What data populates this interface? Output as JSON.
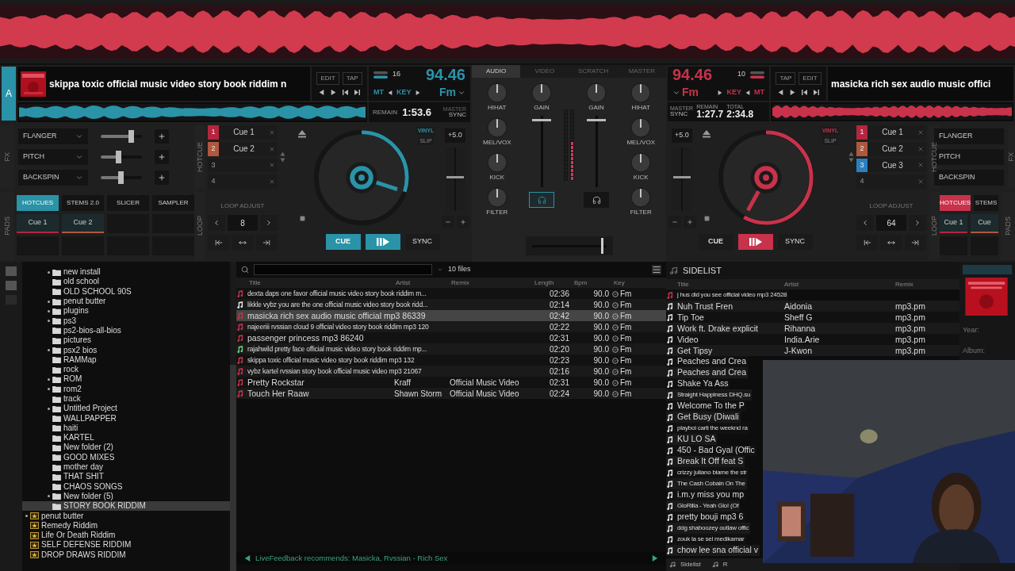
{
  "decks": [
    {
      "letter": "A",
      "art": {
        "kind": "picture"
      },
      "title": "skippa toxic official music video story book riddim n",
      "edit": "EDIT",
      "tap": "TAP",
      "pitch_range": "16",
      "bpm": "94.46",
      "mt": "MT",
      "key_label": "KEY",
      "key": "Fm",
      "remain_label": "REMAIN",
      "remain": "1:53.6",
      "master": "MASTER",
      "sync_label": "SYNC",
      "color": "#2a93a8",
      "position": {
        "level": 0.3
      },
      "fx_label": "FX",
      "fx": [
        {
          "name": "FLANGER",
          "level": 0.75
        },
        {
          "name": "PITCH",
          "level": 0.45
        },
        {
          "name": "BACKSPIN",
          "level": 0.5
        }
      ],
      "hotcue_label": "HOTCUE",
      "hotcues": [
        {
          "number": "1",
          "label": "Cue 1",
          "color": "#b3263e"
        },
        {
          "number": "2",
          "label": "Cue 2",
          "color": "#b0583c"
        },
        {
          "number": "3"
        },
        {
          "number": "4"
        }
      ],
      "pads_label": "PADS",
      "pad_tabs": [
        {
          "label": "HOTCUES",
          "selected": true
        },
        {
          "label": "STEMS 2.0",
          "selected": false
        },
        {
          "label": "SLICER",
          "selected": false
        },
        {
          "label": "SAMPLER",
          "selected": false
        }
      ],
      "pads": [
        {
          "label": "Cue 1",
          "color": "#b3263e"
        },
        {
          "label": "Cue 2",
          "color": "#b0583c"
        }
      ],
      "loop_label": "LOOP",
      "loop_title": "LOOP ADJUST",
      "loop_value": "8",
      "pitch": "+5.0",
      "vinyl": "VINYL",
      "slip": "SLIP",
      "cue": "CUE",
      "cue_active": true,
      "sync": "SYNC"
    },
    {
      "title": "masicka rich sex audio music offici",
      "edit": "EDIT",
      "tap": "TAP",
      "pitch_range": "10",
      "bpm": "94.46",
      "mt": "MT",
      "key_label": "KEY",
      "key": "Fm",
      "remain_label": "REMAIN",
      "remain": "1:27.7",
      "total_label": "TOTAL",
      "total": "2:34.8",
      "master": "MASTER",
      "sync_label": "SYNC",
      "color": "#c8324b",
      "position": {
        "level": 0.58
      },
      "fx_label": "FX",
      "fx": [
        {
          "name": "FLANGER"
        },
        {
          "name": "PITCH"
        },
        {
          "name": "BACKSPIN"
        }
      ],
      "hotcue_label": "HOTCUE",
      "hotcues": [
        {
          "number": "1",
          "label": "Cue 1",
          "color": "#b3263e"
        },
        {
          "number": "2",
          "label": "Cue 2",
          "color": "#b0583c"
        },
        {
          "number": "3",
          "label": "Cue 3",
          "color": "#2a7fc0"
        },
        {
          "number": "4"
        }
      ],
      "pads_label": "PADS",
      "pad_tabs": [
        {
          "label": "HOTCUES",
          "selected": true
        },
        {
          "label": "STEMS",
          "selected": false
        }
      ],
      "pads": [
        {
          "label": "Cue 1",
          "color": "#b3263e"
        },
        {
          "label": "Cue",
          "color": "#b0583c"
        }
      ],
      "loop_label": "LOOP",
      "loop_title": "LOOP ADJUST",
      "loop_value": "64",
      "pitch": "+5.0",
      "vinyl": "VINYL",
      "slip": "SLIP",
      "cue": "CUE",
      "cue_active": false,
      "sync": "SYNC"
    }
  ],
  "mixer": {
    "tabs": [
      {
        "label": "AUDIO",
        "selected": true
      },
      {
        "label": "VIDEO",
        "selected": false
      },
      {
        "label": "SCRATCH",
        "selected": false
      },
      {
        "label": "MASTER",
        "selected": false
      }
    ],
    "channels": [
      {
        "eq": [
          "HIHAT",
          "MEL/VOX",
          "KICK",
          "FILTER"
        ],
        "gain": "GAIN",
        "headphone_on": true,
        "fader": {
          "level": 0.95
        },
        "meter": {
          "level": 0
        }
      },
      {
        "eq": [
          "HIHAT",
          "MEL/VOX",
          "KICK",
          "FILTER"
        ],
        "gain": "GAIN",
        "headphone_on": false,
        "fader": {
          "level": 0.95
        },
        "meter": {
          "level": 0.55
        }
      }
    ],
    "crossfader": {
      "level": 0.95
    }
  },
  "folders": [
    {
      "label": "new install",
      "expandable": true,
      "selected": false
    },
    {
      "label": "old school",
      "expandable": false,
      "selected": false
    },
    {
      "label": "OLD SCHOOL 90S",
      "expandable": false,
      "selected": false
    },
    {
      "label": "penut butter",
      "expandable": true,
      "selected": false
    },
    {
      "label": "plugins",
      "expandable": true,
      "selected": false
    },
    {
      "label": "ps3",
      "expandable": true,
      "selected": false
    },
    {
      "label": "ps2-bios-all-bios",
      "expandable": false,
      "selected": false
    },
    {
      "label": "pictures",
      "expandable": false,
      "selected": false
    },
    {
      "label": "psx2 bios",
      "expandable": true,
      "selected": false
    },
    {
      "label": "RAMMap",
      "expandable": false,
      "selected": false
    },
    {
      "label": "rock",
      "expandable": false,
      "selected": false
    },
    {
      "label": "ROM",
      "expandable": true,
      "selected": false
    },
    {
      "label": "rom2",
      "expandable": true,
      "selected": false
    },
    {
      "label": "track",
      "expandable": false,
      "selected": false
    },
    {
      "label": "Untitled Project",
      "expandable": true,
      "selected": false
    },
    {
      "label": "WALLPAPPER",
      "expandable": false,
      "selected": false
    },
    {
      "label": "haiti",
      "expandable": false,
      "selected": false
    },
    {
      "label": "KARTEL",
      "expandable": false,
      "selected": false
    },
    {
      "label": "New folder (2)",
      "expandable": false,
      "selected": false
    },
    {
      "label": "GOOD MIXES",
      "expandable": false,
      "selected": false
    },
    {
      "label": "mother day",
      "expandable": false,
      "selected": false
    },
    {
      "label": "THAT SHIT",
      "expandable": false,
      "selected": false
    },
    {
      "label": "CHAOS SONGS",
      "expandable": false,
      "selected": false
    },
    {
      "label": "New folder (5)",
      "expandable": true,
      "selected": false
    },
    {
      "label": "STORY BOOK RIDDIM",
      "expandable": false,
      "selected": true
    }
  ],
  "favorites": [
    {
      "label": "penut butter",
      "expandable": true,
      "selected": false
    },
    {
      "label": "Remedy Riddim",
      "expandable": false,
      "selected": false
    },
    {
      "label": "Life Or Death Riddim",
      "expandable": false,
      "selected": false
    },
    {
      "label": "SELF DEFENSE RIDDIM",
      "expandable": false,
      "selected": false
    },
    {
      "label": "DROP DRAWS RIDDIM",
      "expandable": false,
      "selected": false
    }
  ],
  "file_list": {
    "count": "10 files",
    "columns": [
      "Title",
      "Artist",
      "Remix",
      "Length",
      "Bpm",
      "Key"
    ],
    "rows": [
      {
        "title": "dexta daps one favor official music video story book riddim m...",
        "length": "02:36",
        "bpm": "90.0",
        "key": "Fm",
        "color": "#c8324b",
        "condensed": true,
        "selected": false
      },
      {
        "title": "likkle vybz you are the one official music video story book ridd...",
        "length": "02:14",
        "bpm": "90.0",
        "key": "Fm",
        "color": "#e6e6e6",
        "condensed": true,
        "selected": false
      },
      {
        "title": "masicka rich sex audio music official mp3 86339",
        "length": "02:42",
        "bpm": "90.0",
        "key": "Fm",
        "color": "#c8324b",
        "condensed": false,
        "selected": true
      },
      {
        "title": "najeeriii rvssian cloud 9 official video story book riddim mp3 120",
        "length": "02:22",
        "bpm": "90.0",
        "key": "Fm",
        "color": "#c8324b",
        "condensed": true,
        "selected": false
      },
      {
        "title": "passenger princess mp3 86240",
        "length": "02:31",
        "bpm": "90.0",
        "key": "Fm",
        "color": "#c8324b",
        "condensed": false,
        "selected": false
      },
      {
        "title": "rajahwild pretty face official music video story book riddim mp...",
        "length": "02:20",
        "bpm": "90.0",
        "key": "Fm",
        "color": "#6fd17a",
        "condensed": true,
        "selected": false
      },
      {
        "title": "skippa toxic official music video story book riddim mp3 132",
        "length": "02:23",
        "bpm": "90.0",
        "key": "Fm",
        "color": "#c8324b",
        "condensed": true,
        "selected": false
      },
      {
        "title": "vybz kartel rvssian story book official music video mp3 21067",
        "length": "02:16",
        "bpm": "90.0",
        "key": "Fm",
        "color": "#c8324b",
        "condensed": true,
        "selected": false
      },
      {
        "title": "Pretty Rockstar",
        "artist": "Kraff",
        "remix": "Official Music Video",
        "length": "02:31",
        "bpm": "90.0",
        "key": "Fm",
        "color": "#c8324b",
        "condensed": false,
        "selected": false
      },
      {
        "title": "Touch Her Raaw",
        "artist": "Shawn Storm",
        "remix": "Official Music Video",
        "length": "02:24",
        "bpm": "90.0",
        "key": "Fm",
        "color": "#c8324b",
        "condensed": false,
        "selected": false
      }
    ]
  },
  "status": "LiveFeedback recommends: Masicka, Rvssian - Rich Sex",
  "sidelist": {
    "title": "SIDELIST",
    "columns": [
      "Title",
      "Artist",
      "Remix"
    ],
    "rows": [
      {
        "title": "j hus did you see official video mp3 24528",
        "color": "#c8324b",
        "condensed": true
      },
      {
        "title": "Nuh Trust Fren",
        "artist": "Aidonia",
        "remix": "mp3.pm",
        "color": "#e6e6e6",
        "condensed": false
      },
      {
        "title": "Tip Toe",
        "artist": "Sheff G",
        "remix": "mp3.pm",
        "color": "#e6e6e6",
        "condensed": false
      },
      {
        "title": "Work ft. Drake explicit",
        "artist": "Rihanna",
        "remix": "mp3.pm",
        "color": "#e6e6e6",
        "condensed": false
      },
      {
        "title": "Video",
        "artist": "India.Arie",
        "remix": "mp3.pm",
        "color": "#e6e6e6",
        "condensed": false
      },
      {
        "title": "Get Tipsy",
        "artist": "J-Kwon",
        "remix": "mp3.pm",
        "color": "#e6e6e6",
        "condensed": false
      },
      {
        "title": "Peaches and Crea",
        "color": "#e6e6e6",
        "condensed": false
      },
      {
        "title": "Peaches and Crea",
        "color": "#e6e6e6",
        "condensed": false
      },
      {
        "title": "Shake Ya Ass",
        "color": "#e6e6e6",
        "condensed": false
      },
      {
        "title": "Straight Happiness DHQ.su",
        "color": "#e6e6e6",
        "condensed": true
      },
      {
        "title": "Welcome To the P",
        "color": "#e6e6e6",
        "condensed": false
      },
      {
        "title": "Get Busy (Diwali",
        "color": "#e6e6e6",
        "condensed": false
      },
      {
        "title": "playboi carti the weeknd ra",
        "color": "#e6e6e6",
        "condensed": true
      },
      {
        "title": "KU LO SA",
        "color": "#e6e6e6",
        "condensed": false
      },
      {
        "title": "450 - Bad Gyal (Offic",
        "color": "#e6e6e6",
        "condensed": false
      },
      {
        "title": "Break It Off feat S",
        "color": "#e6e6e6",
        "condensed": false
      },
      {
        "title": "crizzy juliano blame the str",
        "color": "#e6e6e6",
        "condensed": true
      },
      {
        "title": "The Cash Cobain On The",
        "color": "#e6e6e6",
        "condensed": true
      },
      {
        "title": "i.m.y miss you mp",
        "color": "#e6e6e6",
        "condensed": false
      },
      {
        "title": "GloRilla - Yeah Glo! (Of",
        "color": "#e6e6e6",
        "condensed": true
      },
      {
        "title": "pretty bouji mp3 6",
        "color": "#e6e6e6",
        "condensed": false
      },
      {
        "title": "ddg shaboozey outlaw offic",
        "color": "#e6e6e6",
        "condensed": true
      },
      {
        "title": "zouk la se sel medikamar",
        "color": "#e6e6e6",
        "condensed": true
      },
      {
        "title": "chow lee sna official v",
        "color": "#e6e6e6",
        "condensed": false
      }
    ],
    "footer_tabs": [
      "Sidelist",
      "R"
    ]
  },
  "info": {
    "year_label": "Year:",
    "album_label": "Album:",
    "art": {
      "kind": "picture"
    }
  },
  "webcam": {
    "kind": "picture"
  }
}
